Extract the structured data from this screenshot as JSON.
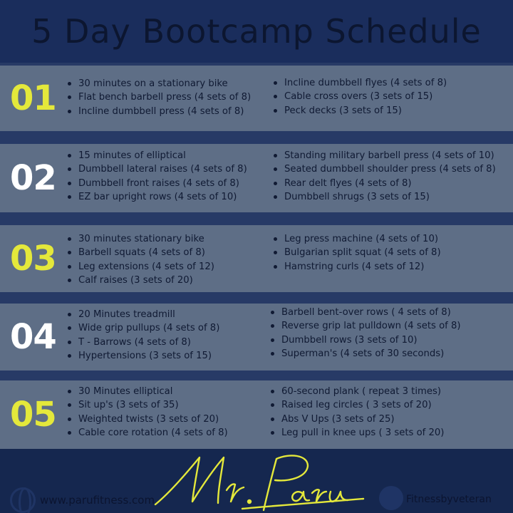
{
  "title": "5 Day Bootcamp Schedule",
  "colors": {
    "background": "#15274f",
    "panel": "#5e6e86",
    "accent_yellow": "#e4e83b",
    "white": "#ffffff",
    "text_dark": "#101a33"
  },
  "days": [
    {
      "number": "01",
      "left": [
        "30 minutes on a stationary bike",
        "Flat bench barbell press (4 sets of 8)",
        "Incline dumbbell press (4 sets of 8)"
      ],
      "right": [
        "Incline dumbbell flyes (4 sets of 8)",
        "Cable cross overs (3 sets of 15)",
        "Peck decks (3 sets of 15)"
      ]
    },
    {
      "number": "02",
      "left": [
        "15 minutes of elliptical",
        "Dumbbell lateral raises (4 sets of 8)",
        "Dumbbell front raises (4 sets of 8)",
        "EZ bar upright rows (4 sets of 10)"
      ],
      "right": [
        "Standing military barbell press (4 sets of 10)",
        "Seated dumbbell shoulder press (4 sets of 8)",
        "Rear delt flyes (4 sets of 8)",
        "Dumbbell shrugs (3 sets of 15)"
      ]
    },
    {
      "number": "03",
      "left": [
        "30 minutes stationary bike",
        "Barbell squats (4 sets of 8)",
        "Leg extensions (4 sets of 12)",
        "Calf raises (3 sets of 20)"
      ],
      "right": [
        "Leg press machine (4 sets of 10)",
        "Bulgarian split squat (4 sets of 8)",
        "Hamstring curls (4 sets of 12)"
      ]
    },
    {
      "number": "04",
      "left": [
        "20 Minutes treadmill",
        "Wide grip pullups (4 sets of 8)",
        "T - Barrows (4 sets of 8)",
        "Hypertensions (3 sets of 15)"
      ],
      "right": [
        "Barbell bent-over rows ( 4 sets of 8)",
        "Reverse grip lat pulldown (4 sets of 8)",
        "Dumbbell rows (3 sets of 10)",
        "Superman's (4 sets of 30 seconds)"
      ]
    },
    {
      "number": "05",
      "left": [
        "30 Minutes elliptical",
        "Sit up's (3 sets of 35)",
        "Weighted twists (3 sets of 20)",
        "Cable core rotation (4 sets of 8)"
      ],
      "right": [
        "60-second plank ( repeat 3 times)",
        "Raised leg circles ( 3 sets of 20)",
        "Abs V Ups (3 sets of 25)",
        "Leg pull in knee ups ( 3 sets of 20)"
      ]
    }
  ],
  "footer": {
    "website": "www.parufitness.com",
    "social": "Fitnessbyveteran",
    "signature": "Mr. Paru",
    "website_icon": "globe-icon",
    "social_icon": "facebook-icon"
  }
}
